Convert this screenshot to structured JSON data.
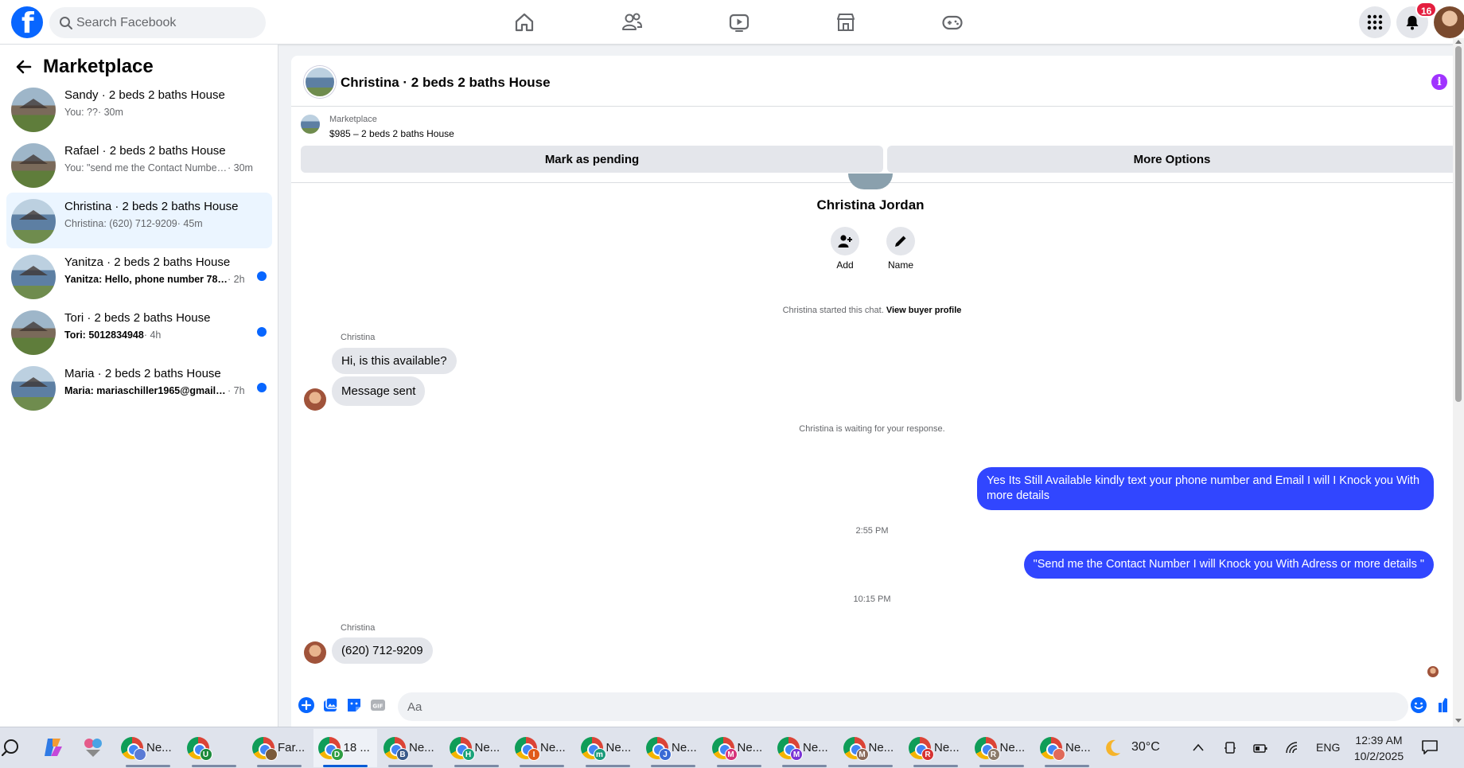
{
  "header": {
    "logo": "f",
    "search_placeholder": "Search Facebook",
    "nav_icons": [
      "home-icon",
      "friends-icon",
      "video-icon",
      "marketplace-icon",
      "gaming-icon"
    ],
    "notification_count": "16"
  },
  "sidebar": {
    "title": "Marketplace",
    "conversations": [
      {
        "title": "Sandy · 2 beds 2 baths House",
        "snippet": "You: ??",
        "time": "· 30m",
        "unread": false,
        "active": false
      },
      {
        "title": "Rafael · 2 beds 2 baths House",
        "snippet": "You: \"send me the Contact Number ...",
        "time": "· 30m",
        "unread": false,
        "active": false
      },
      {
        "title": "Christina · 2 beds 2 baths House",
        "snippet": "Christina: (620) 712-9209",
        "time": "· 45m",
        "unread": false,
        "active": true
      },
      {
        "title": "Yanitza · 2 beds 2 baths House",
        "snippet": "Yanitza: Hello, phone number 787-...",
        "time": "· 2h",
        "unread": true,
        "active": false
      },
      {
        "title": "Tori · 2 beds 2 baths House",
        "snippet": "Tori: 5012834948",
        "time": "· 4h",
        "unread": true,
        "active": false
      },
      {
        "title": "Maria · 2 beds 2 baths House",
        "snippet": "Maria: mariaschiller1965@gmail.c...",
        "time": "· 7h",
        "unread": true,
        "active": false
      }
    ]
  },
  "chat": {
    "header_title": "Christina · 2 beds 2 baths House",
    "listing_label": "Marketplace",
    "listing_price": "$985 – 2 beds 2 baths House",
    "mark_pending": "Mark as pending",
    "more_options": "More Options",
    "buyer_name": "Christina Jordan",
    "add_label": "Add",
    "name_label": "Name",
    "started_note": "Christina started this chat.",
    "view_profile": "View buyer profile",
    "sender_1": "Christina",
    "msg_1": "Hi, is this available?",
    "msg_2": "Message sent",
    "waiting_note": "Christina is waiting for your response.",
    "out_1": "Yes Its Still Available kindly text your phone number and Email I will I Knock you With more details",
    "time_1": "2:55 PM",
    "out_2": "\"Send me the Contact Number I will Knock you With Adress or more details \"",
    "time_2": "10:15 PM",
    "sender_2": "Christina",
    "msg_3": "(620) 712-9209",
    "composer_placeholder": "Aa"
  },
  "taskbar": {
    "items": [
      {
        "label": "Ne...",
        "badge": "",
        "badge_color": "#5b7bd5",
        "active": false
      },
      {
        "label": "",
        "badge": "U",
        "badge_color": "#1a8a3a",
        "active": false
      },
      {
        "label": "Far...",
        "badge": "",
        "badge_color": "#7a5a3a",
        "active": false
      },
      {
        "label": "18 ...",
        "badge": "D",
        "badge_color": "#2f9e44",
        "active": true
      },
      {
        "label": "Ne...",
        "badge": "B",
        "badge_color": "#3b5b8a",
        "active": false
      },
      {
        "label": "Ne...",
        "badge": "H",
        "badge_color": "#1aa37a",
        "active": false
      },
      {
        "label": "Ne...",
        "badge": "I",
        "badge_color": "#e05a1a",
        "active": false
      },
      {
        "label": "Ne...",
        "badge": "m",
        "badge_color": "#1a9a7a",
        "active": false
      },
      {
        "label": "Ne...",
        "badge": "J",
        "badge_color": "#3a6ad5",
        "active": false
      },
      {
        "label": "Ne...",
        "badge": "M",
        "badge_color": "#d5337a",
        "active": false
      },
      {
        "label": "Ne...",
        "badge": "M",
        "badge_color": "#7a33d5",
        "active": false
      },
      {
        "label": "Ne...",
        "badge": "M",
        "badge_color": "#8a6a5a",
        "active": false
      },
      {
        "label": "Ne...",
        "badge": "R",
        "badge_color": "#d53333",
        "active": false
      },
      {
        "label": "Ne...",
        "badge": "R",
        "badge_color": "#8a7a6a",
        "active": false
      },
      {
        "label": "Ne...",
        "badge": "",
        "badge_color": "#e06a5a",
        "active": false
      }
    ],
    "temperature": "30°C",
    "language": "ENG",
    "time": "12:39 AM",
    "date": "10/2/2025"
  },
  "colors": {
    "brand": "#0866ff",
    "outgoing_bubble": "#3146ff",
    "incoming_bubble": "#e4e6eb",
    "unread_dot": "#0866ff",
    "badge": "#e41e3f"
  }
}
